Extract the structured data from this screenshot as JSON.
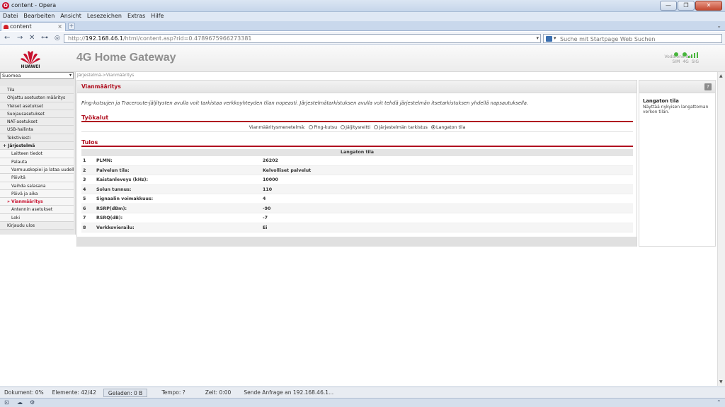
{
  "window": {
    "title": "content - Opera",
    "controls": [
      "—",
      "❐",
      "✕"
    ]
  },
  "menu": [
    "Datei",
    "Bearbeiten",
    "Ansicht",
    "Lesezeichen",
    "Extras",
    "Hilfe"
  ],
  "tabs": [
    {
      "label": "content",
      "close": "×"
    }
  ],
  "new_tab": "+",
  "tab_menu": "⌄",
  "nav": {
    "back": "←",
    "forward": "→",
    "stop": "✕",
    "key": "⊶",
    "url_host": "192.168.46.1",
    "url_prefix": "http://",
    "url_path": "/html/content.asp?rid=0.4789675966273381",
    "url_dropdown": "▾"
  },
  "search": {
    "placeholder": "Suche mit Startpage Web Suchen",
    "dropdown": "▾"
  },
  "brand": {
    "text": "HUAWEI",
    "color": "#c8102e"
  },
  "app": {
    "title": "4G Home Gateway"
  },
  "status": {
    "operator": "Vodafone.de",
    "labels": [
      "SIM",
      "4G",
      "SIG"
    ],
    "led_color": "#47b53c",
    "signal_bars": 4
  },
  "sidebar": {
    "language": "Suomea",
    "language_arrow": "▾",
    "items": [
      {
        "label": "Tila",
        "level": 0
      },
      {
        "label": "Ohjattu asetusten määritys",
        "level": 0
      },
      {
        "label": "Yleiset asetukset",
        "level": 0
      },
      {
        "label": "Suojausasetukset",
        "level": 0
      },
      {
        "label": "NAT-asetukset",
        "level": 0
      },
      {
        "label": "USB-hallinta",
        "level": 0
      },
      {
        "label": "Tekstiviesti",
        "level": 0
      },
      {
        "label": "+ Järjestelmä",
        "level": 0
      },
      {
        "label": "Laitteen tiedot",
        "level": 1
      },
      {
        "label": "Palauta",
        "level": 1
      },
      {
        "label": "Varmuuskopioi ja lataa uudelleen",
        "level": 1
      },
      {
        "label": "Päivitä",
        "level": 1
      },
      {
        "label": "Vaihda salasana",
        "level": 1
      },
      {
        "label": "Päivä ja aika",
        "level": 1
      },
      {
        "label": "» Vianmääritys",
        "level": 1
      },
      {
        "label": "Antennin asetukset",
        "level": 1
      },
      {
        "label": "Loki",
        "level": 1
      },
      {
        "label": "Kirjaudu ulos",
        "level": 0
      }
    ]
  },
  "breadcrumb": "Järjestelmä->Vianmääritys",
  "page": {
    "title": "Vianmääritys",
    "description": "Ping-kutsujen ja Traceroute-jäljitysten avulla voit tarkistaa verkkoyhteyden tilan nopeasti. Järjestelmätarkistuksen avulla voit tehdä järjestelmän itsetarkistuksen yhdellä napsautuksella.",
    "tools_title": "Työkalut",
    "method_label": "Vianmääritysmenetelmä:",
    "methods": [
      {
        "label": "Ping-kutsu",
        "selected": false
      },
      {
        "label": "Jäljitysreitti",
        "selected": false
      },
      {
        "label": "Järjestelmän tarkistus",
        "selected": false
      },
      {
        "label": "Langaton tila",
        "selected": true
      }
    ],
    "results_title": "Tulos",
    "table_header": "Langaton tila",
    "rows": [
      {
        "n": "1",
        "k": "PLMN:",
        "v": "26202"
      },
      {
        "n": "2",
        "k": "Palvelun tila:",
        "v": "Kelvolliset palvelut"
      },
      {
        "n": "3",
        "k": "Kaistanleveys (kHz):",
        "v": "10000"
      },
      {
        "n": "4",
        "k": "Solun tunnus:",
        "v": "110"
      },
      {
        "n": "5",
        "k": "Signaalin voimakkuus:",
        "v": "4"
      },
      {
        "n": "6",
        "k": "RSRP(dBm):",
        "v": "-90"
      },
      {
        "n": "7",
        "k": "RSRQ(dB):",
        "v": "-7"
      },
      {
        "n": "8",
        "k": "Verkkovierailu:",
        "v": "Ei"
      }
    ]
  },
  "help": {
    "button": "?",
    "title": "Langaton tila",
    "text": "Näyttää nykyisen langattoman verkon tilan."
  },
  "scroll": {
    "up": "▲",
    "down": "▼"
  },
  "statusbar": {
    "doc": "Dokument:  0%",
    "elements": "Elemente:  42/42",
    "loaded": "Geladen:  0 B",
    "tempo": "Tempo:  ?",
    "time": "Zeit:  0:00",
    "message": "Sende Anfrage an 192.168.46.1..."
  },
  "bottom_icons": [
    "⊡",
    "☁",
    "⚙",
    "⌃"
  ]
}
